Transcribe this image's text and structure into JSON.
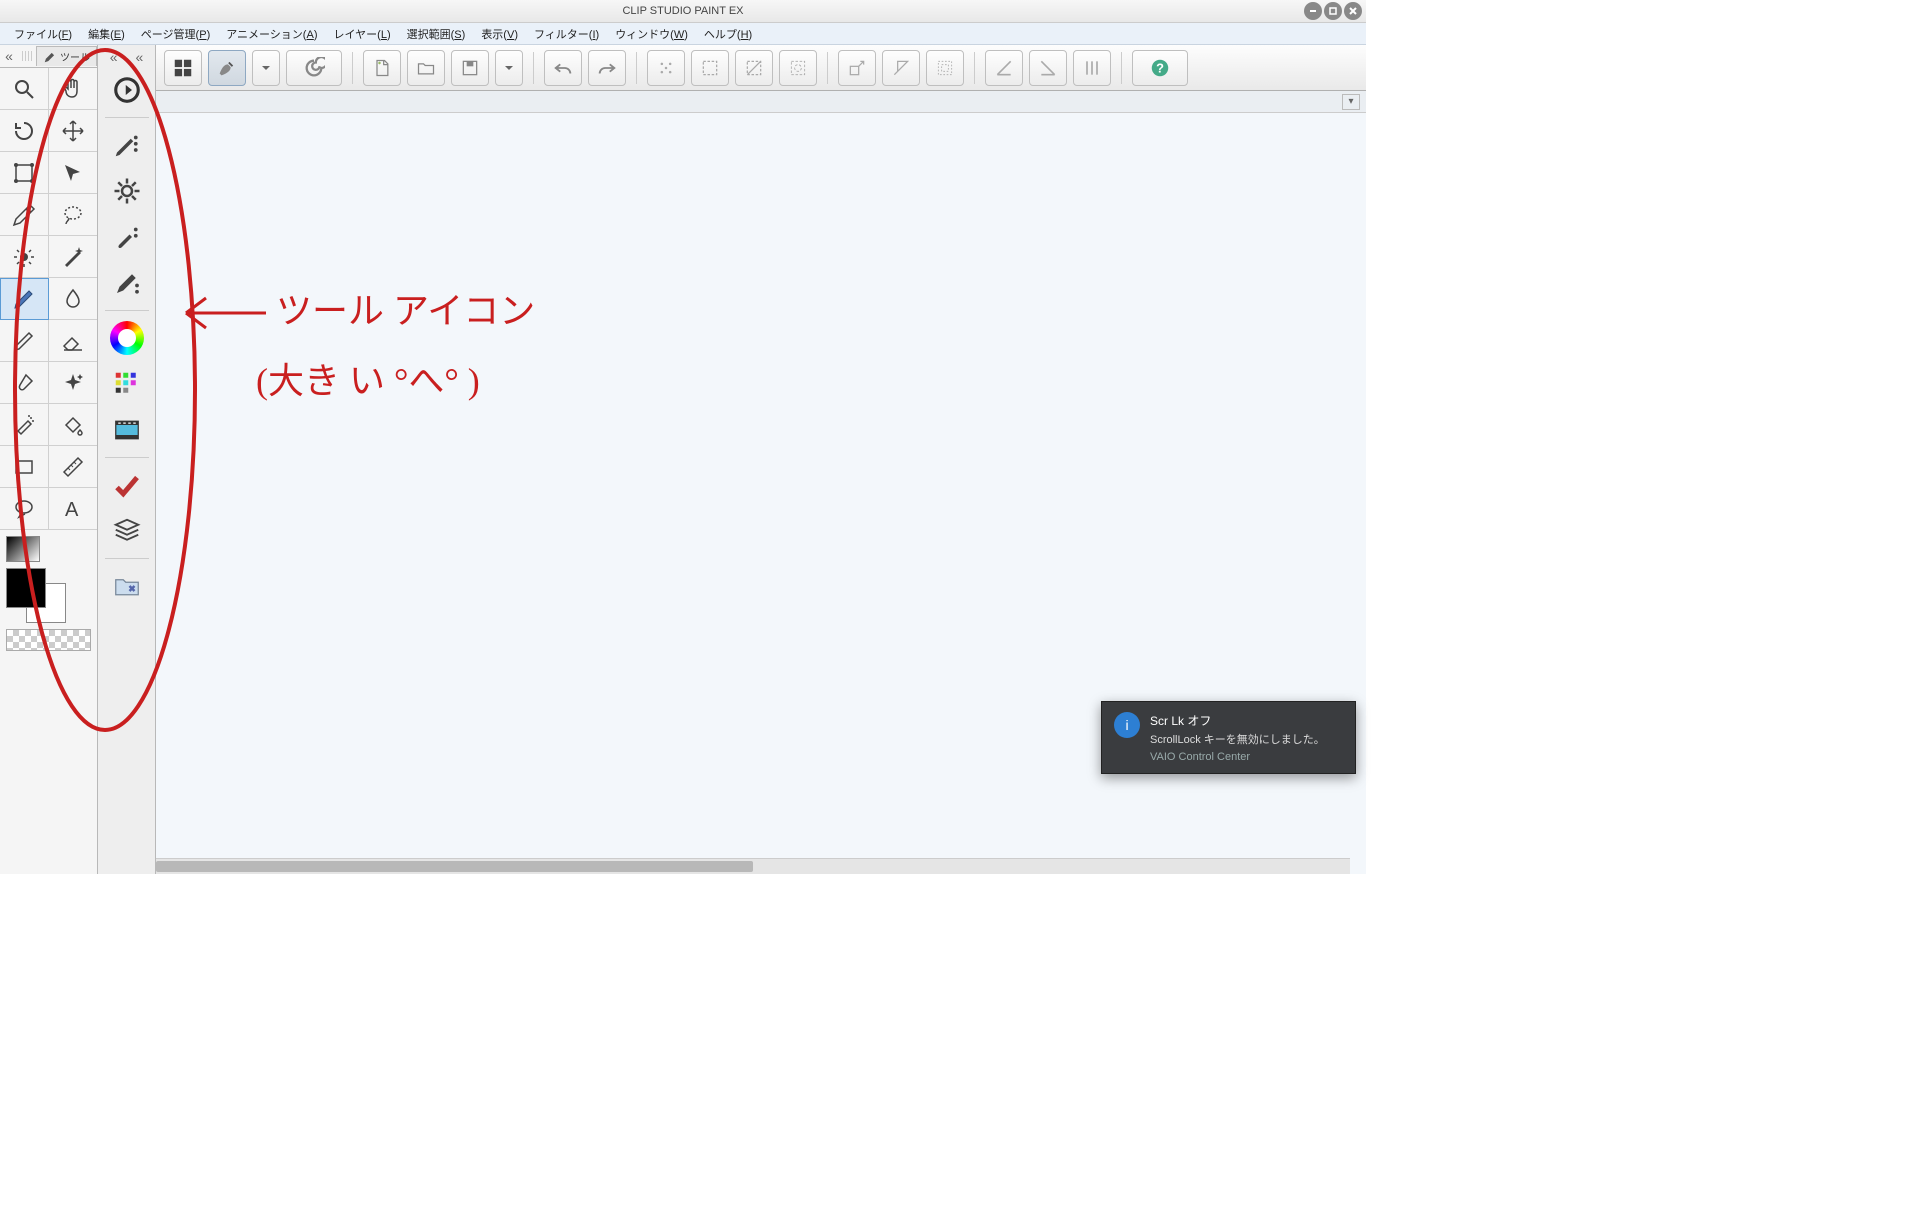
{
  "title": "CLIP STUDIO PAINT EX",
  "menu": [
    {
      "l": "ファイル",
      "u": "F"
    },
    {
      "l": "編集",
      "u": "E"
    },
    {
      "l": "ページ管理",
      "u": "P"
    },
    {
      "l": "アニメーション",
      "u": "A"
    },
    {
      "l": "レイヤー",
      "u": "L"
    },
    {
      "l": "選択範囲",
      "u": "S"
    },
    {
      "l": "表示",
      "u": "V"
    },
    {
      "l": "フィルター",
      "u": "I"
    },
    {
      "l": "ウィンドウ",
      "u": "W"
    },
    {
      "l": "ヘルプ",
      "u": "H"
    }
  ],
  "toolTab": "ツール",
  "tools": [
    {
      "n": "zoom"
    },
    {
      "n": "hand"
    },
    {
      "n": "rotate"
    },
    {
      "n": "move"
    },
    {
      "n": "operation"
    },
    {
      "n": "arrow"
    },
    {
      "n": "eyedropper"
    },
    {
      "n": "lasso"
    },
    {
      "n": "light"
    },
    {
      "n": "wand"
    },
    {
      "n": "pen",
      "sel": true
    },
    {
      "n": "droplet"
    },
    {
      "n": "pencil"
    },
    {
      "n": "eraser"
    },
    {
      "n": "brush2"
    },
    {
      "n": "sparkle"
    },
    {
      "n": "airbrush"
    },
    {
      "n": "fill"
    },
    {
      "n": "rect"
    },
    {
      "n": "ruler"
    },
    {
      "n": "balloon"
    },
    {
      "n": "text"
    }
  ],
  "col2": [
    {
      "t": "quick-access",
      "i": "qarrow"
    },
    {
      "t": "sep"
    },
    {
      "t": "subtool-pen",
      "i": "pen-dots"
    },
    {
      "t": "subtool-gear",
      "i": "gear"
    },
    {
      "t": "subtool-brush",
      "i": "brush-dots"
    },
    {
      "t": "subtool-pen2",
      "i": "pen-dots2"
    },
    {
      "t": "sep"
    },
    {
      "t": "color-wheel",
      "i": "wheel"
    },
    {
      "t": "color-sliders",
      "i": "sliders"
    },
    {
      "t": "timeline",
      "i": "film"
    },
    {
      "t": "sep"
    },
    {
      "t": "layer",
      "i": "check"
    },
    {
      "t": "layer-stack",
      "i": "stack"
    },
    {
      "t": "sep"
    },
    {
      "t": "material",
      "i": "folder"
    }
  ],
  "topbar": [
    {
      "n": "grid-view",
      "i": "grid4"
    },
    {
      "n": "clip-studio",
      "i": "hand-draw",
      "sel": true,
      "dd": true
    },
    {
      "n": "3d",
      "i": "spiral",
      "wide": true
    },
    {
      "sep": true
    },
    {
      "n": "new",
      "i": "newdoc"
    },
    {
      "n": "open",
      "i": "folder"
    },
    {
      "n": "save",
      "i": "save",
      "dd": true
    },
    {
      "sep": true
    },
    {
      "n": "undo",
      "i": "undo"
    },
    {
      "n": "redo",
      "i": "redo"
    },
    {
      "sep": true
    },
    {
      "n": "clear",
      "i": "clear"
    },
    {
      "n": "select-all",
      "i": "selall"
    },
    {
      "n": "deselect",
      "i": "desel"
    },
    {
      "n": "invert",
      "i": "inv"
    },
    {
      "sep": true
    },
    {
      "n": "scale",
      "i": "scale"
    },
    {
      "n": "transform",
      "i": "xform"
    },
    {
      "n": "border",
      "i": "border"
    },
    {
      "sep": true
    },
    {
      "n": "snap1",
      "i": "snap1"
    },
    {
      "n": "snap2",
      "i": "snap2"
    },
    {
      "n": "snap3",
      "i": "snap3"
    },
    {
      "sep": true
    },
    {
      "n": "help",
      "i": "help",
      "wide": true
    }
  ],
  "annotation": {
    "line1": "ツール アイコン",
    "line2": "(大き い °へ° )"
  },
  "toast": {
    "title": "Scr Lk オフ",
    "body": "ScrollLock キーを無効にしました。",
    "source": "VAIO Control Center"
  }
}
